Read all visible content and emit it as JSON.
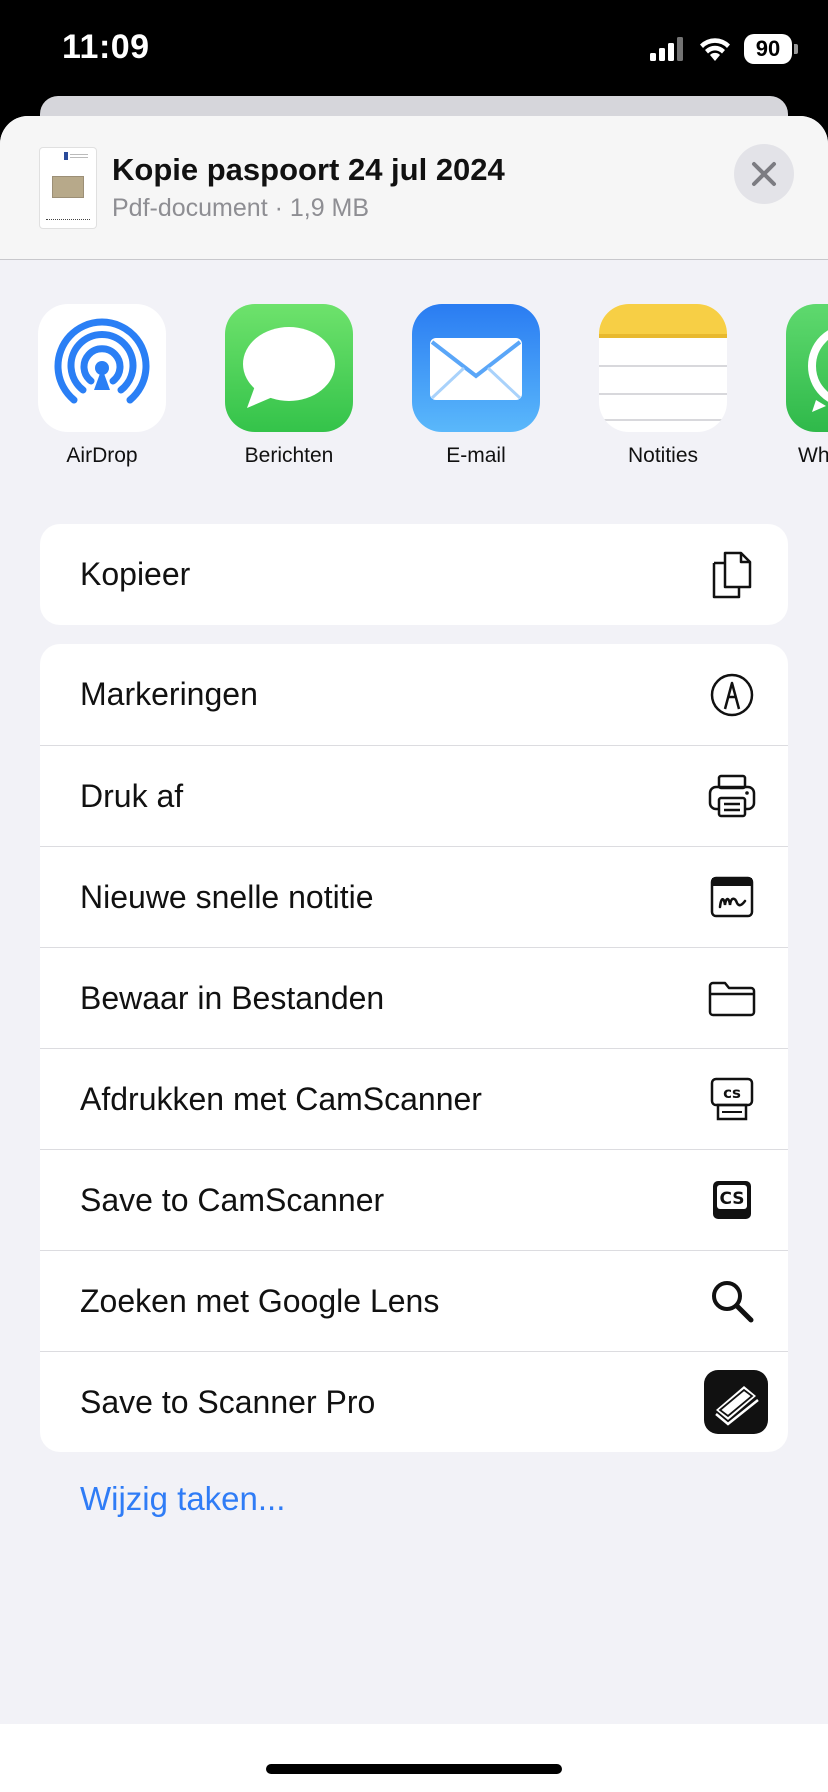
{
  "status_bar": {
    "time": "11:09",
    "battery": "90"
  },
  "header": {
    "title": "Kopie paspoort 24 jul 2024",
    "subtitle": "Pdf-document · 1,9 MB"
  },
  "apps": [
    {
      "label": "AirDrop",
      "icon": "airdrop-icon"
    },
    {
      "label": "Berichten",
      "icon": "messages-icon"
    },
    {
      "label": "E-mail",
      "icon": "mail-icon"
    },
    {
      "label": "Notities",
      "icon": "notes-icon"
    },
    {
      "label": "Wh",
      "icon": "whatsapp-icon"
    }
  ],
  "actions_primary": [
    {
      "label": "Kopieer",
      "icon": "copy-icon"
    }
  ],
  "actions": [
    {
      "label": "Markeringen",
      "icon": "markup-icon"
    },
    {
      "label": "Druk af",
      "icon": "printer-icon"
    },
    {
      "label": "Nieuwe snelle notitie",
      "icon": "quick-note-icon"
    },
    {
      "label": "Bewaar in Bestanden",
      "icon": "folder-icon"
    },
    {
      "label": "Afdrukken met CamScanner",
      "icon": "camscanner-print-icon"
    },
    {
      "label": "Save to CamScanner",
      "icon": "camscanner-icon"
    },
    {
      "label": "Zoeken met Google Lens",
      "icon": "search-icon"
    },
    {
      "label": "Save to Scanner Pro",
      "icon": "scanner-pro-icon"
    }
  ],
  "edit_actions": "Wijzig taken..."
}
